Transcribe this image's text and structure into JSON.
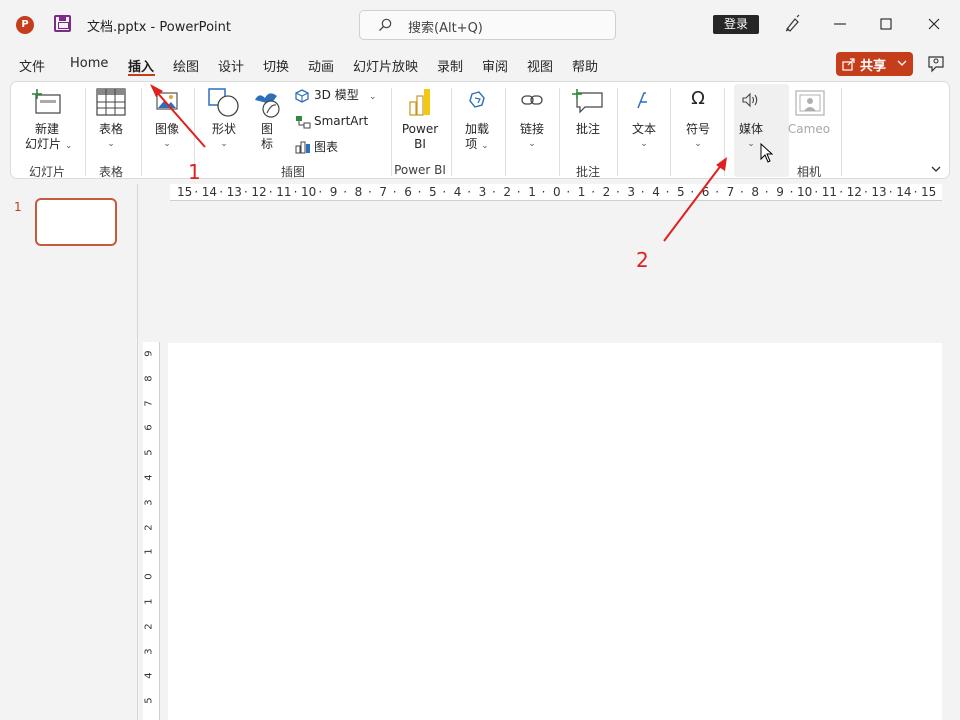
{
  "titlebar": {
    "app_logo_letter": "P",
    "doc_title": "文档.pptx  -  PowerPoint",
    "search_placeholder": "搜索(Alt+Q)",
    "login_label": "登录"
  },
  "menu": {
    "tabs": [
      "文件",
      "Home",
      "插入",
      "绘图",
      "设计",
      "切换",
      "动画",
      "幻灯片放映",
      "录制",
      "审阅",
      "视图",
      "帮助"
    ],
    "active_tab": "插入",
    "share_label": "共享"
  },
  "ribbon": {
    "new_slide": [
      "新建",
      "幻灯片"
    ],
    "table": "表格",
    "image": "图像",
    "shape": "形状",
    "icon": [
      "图",
      "标"
    ],
    "model3d": "3D 模型",
    "smartart": "SmartArt",
    "chart": "图表",
    "powerbi": [
      "Power",
      "BI"
    ],
    "addins": [
      "加载",
      "项"
    ],
    "link": "链接",
    "comment": "批注",
    "text": "文本",
    "symbol": "符号",
    "media": "媒体",
    "cameo": "Cameo",
    "groups": {
      "slides": "幻灯片",
      "tables": "表格",
      "illustrations": "插图",
      "powerbi": "Power BI",
      "comments": "批注",
      "camera": "相机"
    }
  },
  "thumbnails": {
    "slide_number": "1"
  },
  "ruler": {
    "horizontal": [
      "15",
      "14",
      "13",
      "12",
      "11",
      "10",
      "9",
      "8",
      "7",
      "6",
      "5",
      "4",
      "3",
      "2",
      "1",
      "0",
      "1",
      "2",
      "3",
      "4",
      "5",
      "6",
      "7",
      "8",
      "9",
      "10",
      "11",
      "12",
      "13",
      "14",
      "15"
    ],
    "vertical": [
      "9",
      "8",
      "7",
      "6",
      "5",
      "4",
      "3",
      "2",
      "1",
      "0",
      "1",
      "2",
      "3",
      "4",
      "5"
    ]
  },
  "annotations": {
    "label_1": "1",
    "label_2": "2",
    "color": "#e02020"
  },
  "colors": {
    "accent": "#c43e1c",
    "ribbon_bg": "#ffffff",
    "window_bg": "#f3f3f3"
  }
}
